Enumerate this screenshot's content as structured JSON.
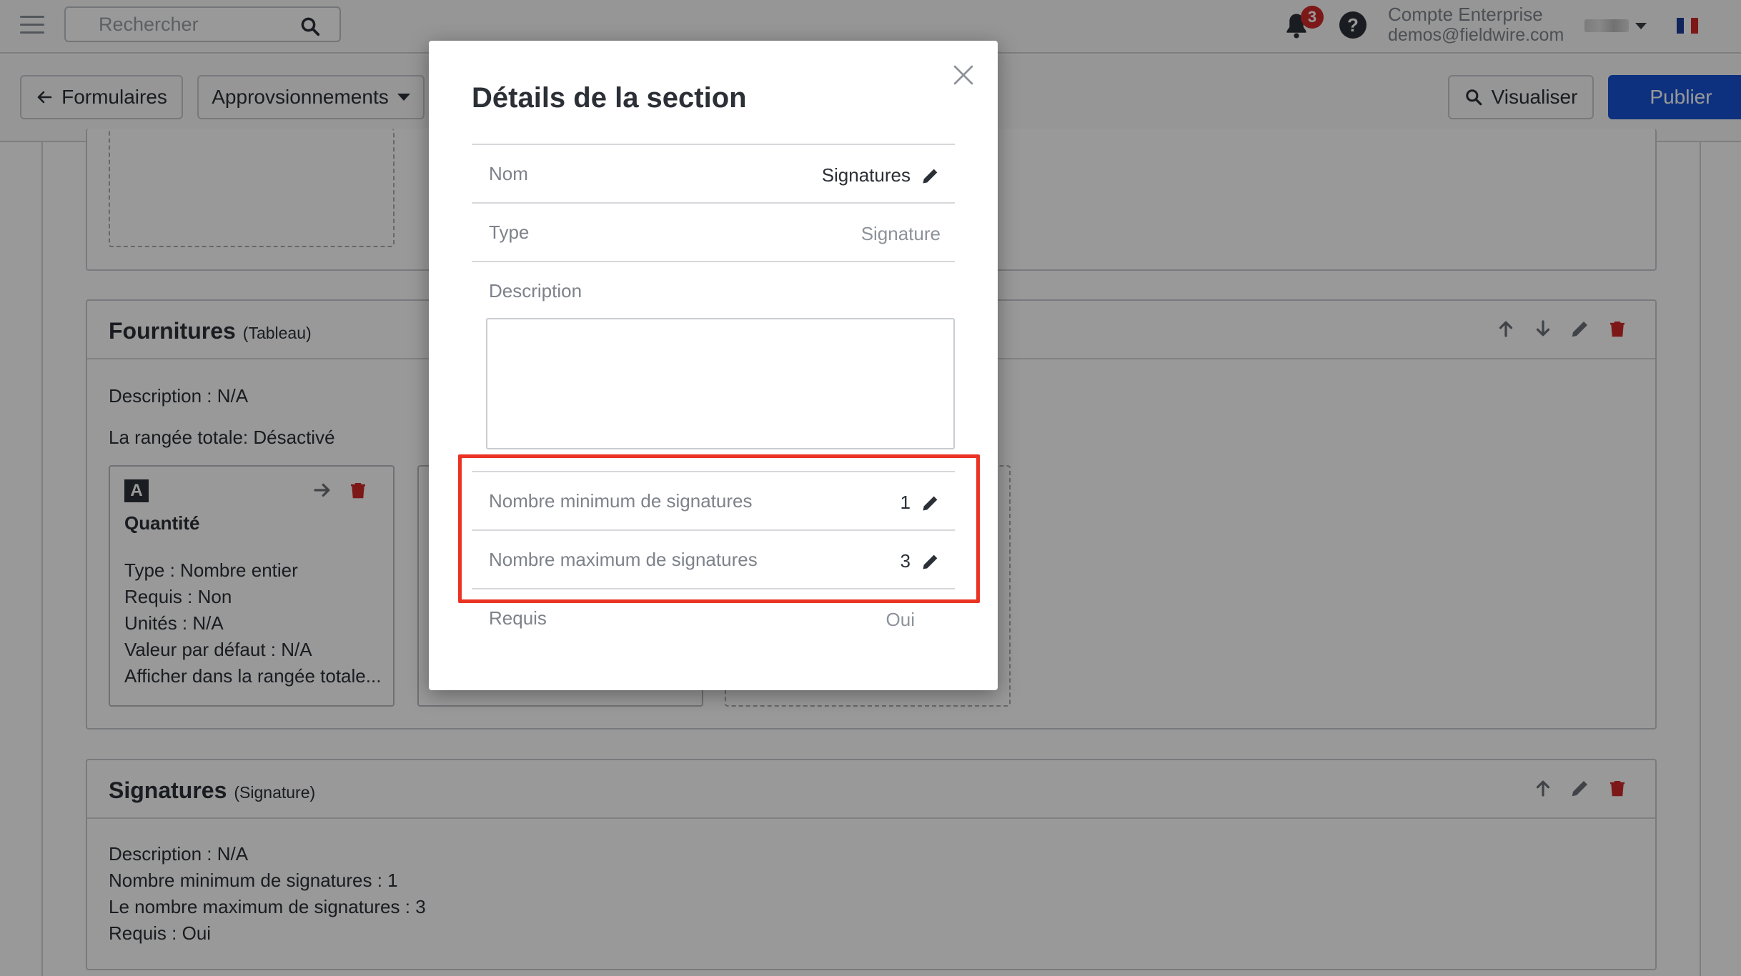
{
  "topbar": {
    "search_placeholder": "Rechercher",
    "notification_count": "3",
    "help_label": "?",
    "account_name": "Compte Enterprise",
    "account_email": "demos@fieldwire.com"
  },
  "toolbar": {
    "back_label": "Formulaires",
    "category_label": "Approvsionnements",
    "preview_label": "Visualiser",
    "publish_label": "Publier"
  },
  "sections": {
    "supplies": {
      "title": "Fournitures",
      "type": "(Tableau)",
      "description": "Description : N/A",
      "total_row": "La rangée totale: Désactivé",
      "field": {
        "type_badge": "A",
        "name": "Quantité",
        "details": [
          "Type : Nombre entier",
          "Requis : Non",
          "Unités : N/A",
          "Valeur par défaut : N/A",
          "Afficher dans la rangée totale..."
        ]
      }
    },
    "signatures": {
      "title": "Signatures",
      "type": "(Signature)",
      "details": [
        "Description : N/A",
        "Nombre minimum de signatures : 1",
        "Le nombre maximum de signatures : 3",
        "Requis : Oui"
      ]
    }
  },
  "modal": {
    "title": "Détails de la section",
    "rows": {
      "name": {
        "label": "Nom",
        "value": "Signatures"
      },
      "type": {
        "label": "Type",
        "value": "Signature"
      },
      "description": {
        "label": "Description",
        "value": ""
      },
      "min": {
        "label": "Nombre minimum de signatures",
        "value": "1"
      },
      "max": {
        "label": "Nombre maximum de signatures",
        "value": "3"
      },
      "required": {
        "label": "Requis",
        "value": "Oui"
      }
    }
  },
  "colors": {
    "primary": "#1652d4",
    "danger": "#d0282b",
    "highlight": "#ea3323"
  }
}
